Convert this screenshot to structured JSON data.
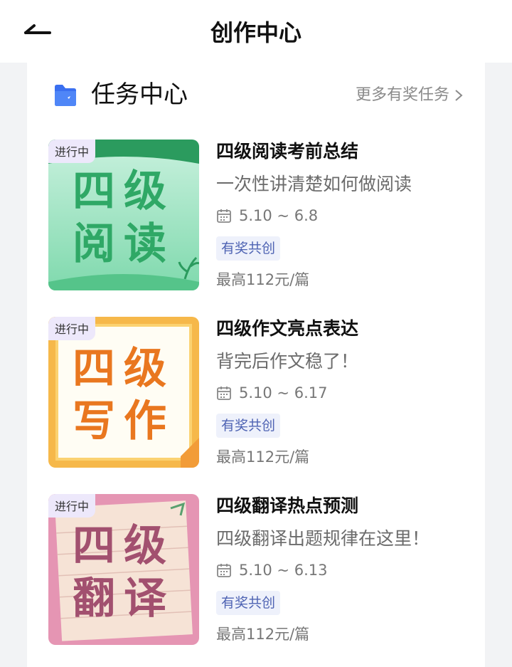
{
  "header": {
    "title": "创作中心"
  },
  "section": {
    "title": "任务中心",
    "more_label": "更多有奖任务"
  },
  "tasks": [
    {
      "status": "进行中",
      "thumb_text": "四级阅读",
      "title": "四级阅读考前总结",
      "desc": "一次性讲清楚如何做阅读",
      "date": "5.10 ~ 6.8",
      "tag": "有奖共创",
      "price": "最高112元/篇"
    },
    {
      "status": "进行中",
      "thumb_text": "四级写作",
      "title": "四级作文亮点表达",
      "desc": "背完后作文稳了！",
      "date": "5.10 ~ 6.17",
      "tag": "有奖共创",
      "price": "最高112元/篇"
    },
    {
      "status": "进行中",
      "thumb_text": "四级翻译",
      "title": "四级翻译热点预测",
      "desc": "四级翻译出题规律在这里！",
      "date": "5.10 ~ 6.13",
      "tag": "有奖共创",
      "price": "最高112元/篇"
    }
  ],
  "icons": {
    "back": "back-arrow-icon",
    "section": "folder-icon",
    "more": "chevron-right-icon",
    "date": "calendar-icon"
  },
  "colors": {
    "tag_bg": "#eef1fb",
    "tag_text": "#4e63b3",
    "reading_green": "#2fa866",
    "writing_orange": "#e9771f",
    "translate_pink": "#a2506f"
  }
}
